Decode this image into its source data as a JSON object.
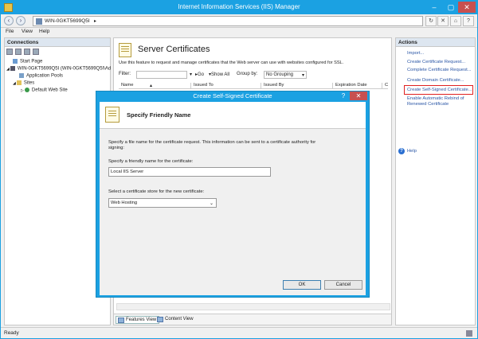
{
  "window": {
    "title": "Internet Information Services (IIS) Manager"
  },
  "address": {
    "path": "WIN-0GKT5699Q5I",
    "arrow": "▸"
  },
  "menu": [
    "File",
    "View",
    "Help"
  ],
  "connections": {
    "header": "Connections",
    "tree": [
      {
        "label": "Start Page",
        "indent": 1,
        "icon": "start-page-icon"
      },
      {
        "label": "WIN-0GKT5699Q5I (WIN-0GKT5699Q5I\\Ad",
        "indent": 0,
        "icon": "server-icon"
      },
      {
        "label": "Application Pools",
        "indent": 2,
        "icon": "app-pools-icon"
      },
      {
        "label": "Sites",
        "indent": 1,
        "icon": "sites-folder-icon"
      },
      {
        "label": "Default Web Site",
        "indent": 2,
        "icon": "globe-icon"
      }
    ]
  },
  "center": {
    "title": "Server Certificates",
    "description": "Use this feature to request and manage certificates that the Web server can use with websites configured for SSL.",
    "filter_label": "Filter:",
    "go_label": "Go",
    "show_all_label": "Show All",
    "group_by_label": "Group by:",
    "group_value": "No Grouping",
    "columns": [
      "Name",
      "Issued To",
      "Issued By",
      "Expiration Date",
      "C"
    ],
    "tabs": [
      "Features View",
      "Content View"
    ]
  },
  "actions": {
    "header": "Actions",
    "items": [
      "Import...",
      "Create Certificate Request...",
      "Complete Certificate Request...",
      "Create Domain Certificate...",
      "Create Self-Signed Certificate...",
      "Enable Automatic Rebind of",
      "Renewed Certificate",
      "Help"
    ]
  },
  "status": {
    "text": "Ready"
  },
  "dialog": {
    "title": "Create Self-Signed Certificate",
    "help_glyph": "?",
    "close_glyph": "✕",
    "heading": "Specify Friendly Name",
    "description": "Specify a file name for the certificate request.  This information can be sent to a certificate authority for signing:",
    "name_label": "Specify a friendly name for the certificate:",
    "name_value": "Local IIS Server",
    "store_label": "Select a certificate store for the new certificate:",
    "store_value": "Web Hosting",
    "ok": "OK",
    "cancel": "Cancel"
  }
}
